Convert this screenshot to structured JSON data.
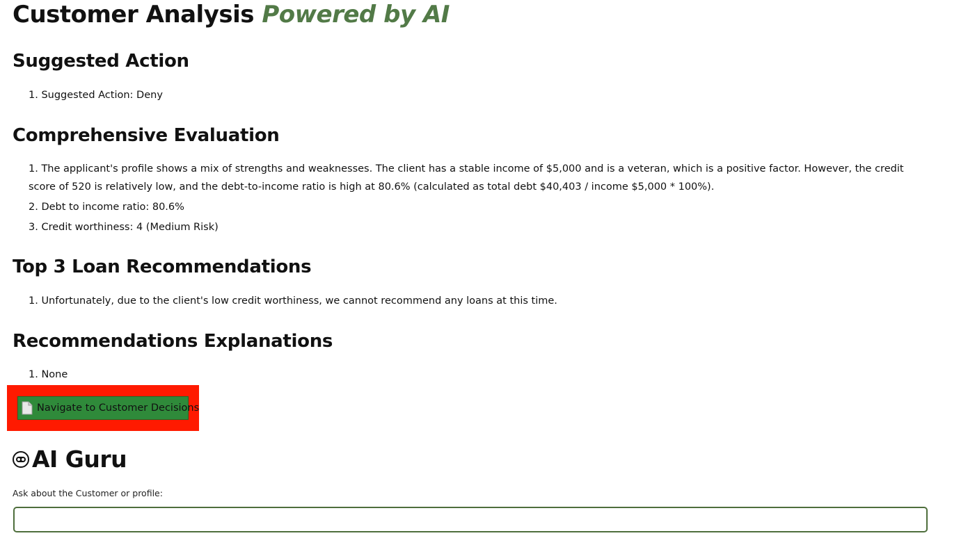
{
  "page": {
    "title_main": "Customer Analysis",
    "title_accent": "Powered by AI",
    "accent_color": "#527a47"
  },
  "sections": {
    "suggested_action": {
      "heading": "Suggested Action",
      "items": [
        "1. Suggested Action: Deny"
      ]
    },
    "comprehensive_evaluation": {
      "heading": "Comprehensive Evaluation",
      "items": [
        "1. The applicant's profile shows a mix of strengths and weaknesses. The client has a stable income of $5,000 and is a veteran, which is a positive factor. However, the credit score of 520 is relatively low, and the debt-to-income ratio is high at 80.6% (calculated as total debt $40,403 / income $5,000 * 100%).",
        "2. Debt to income ratio: 80.6%",
        "3. Credit worthiness: 4 (Medium Risk)"
      ]
    },
    "top_loans": {
      "heading": "Top 3 Loan Recommendations",
      "items": [
        "1. Unfortunately, due to the client's low credit worthiness, we cannot recommend any loans at this time."
      ]
    },
    "explanations": {
      "heading": "Recommendations Explanations",
      "items": [
        "1. None"
      ]
    }
  },
  "navigate_button": {
    "label": "Navigate to Customer Decisions",
    "icon": "document-icon",
    "button_color": "#2f8a3a",
    "highlight_color": "#ff1a00"
  },
  "ai_guru": {
    "title": "AI Guru",
    "icon": "robot-face-icon",
    "ask_label": "Ask about the Customer or profile:",
    "input_value": "",
    "input_placeholder": ""
  }
}
